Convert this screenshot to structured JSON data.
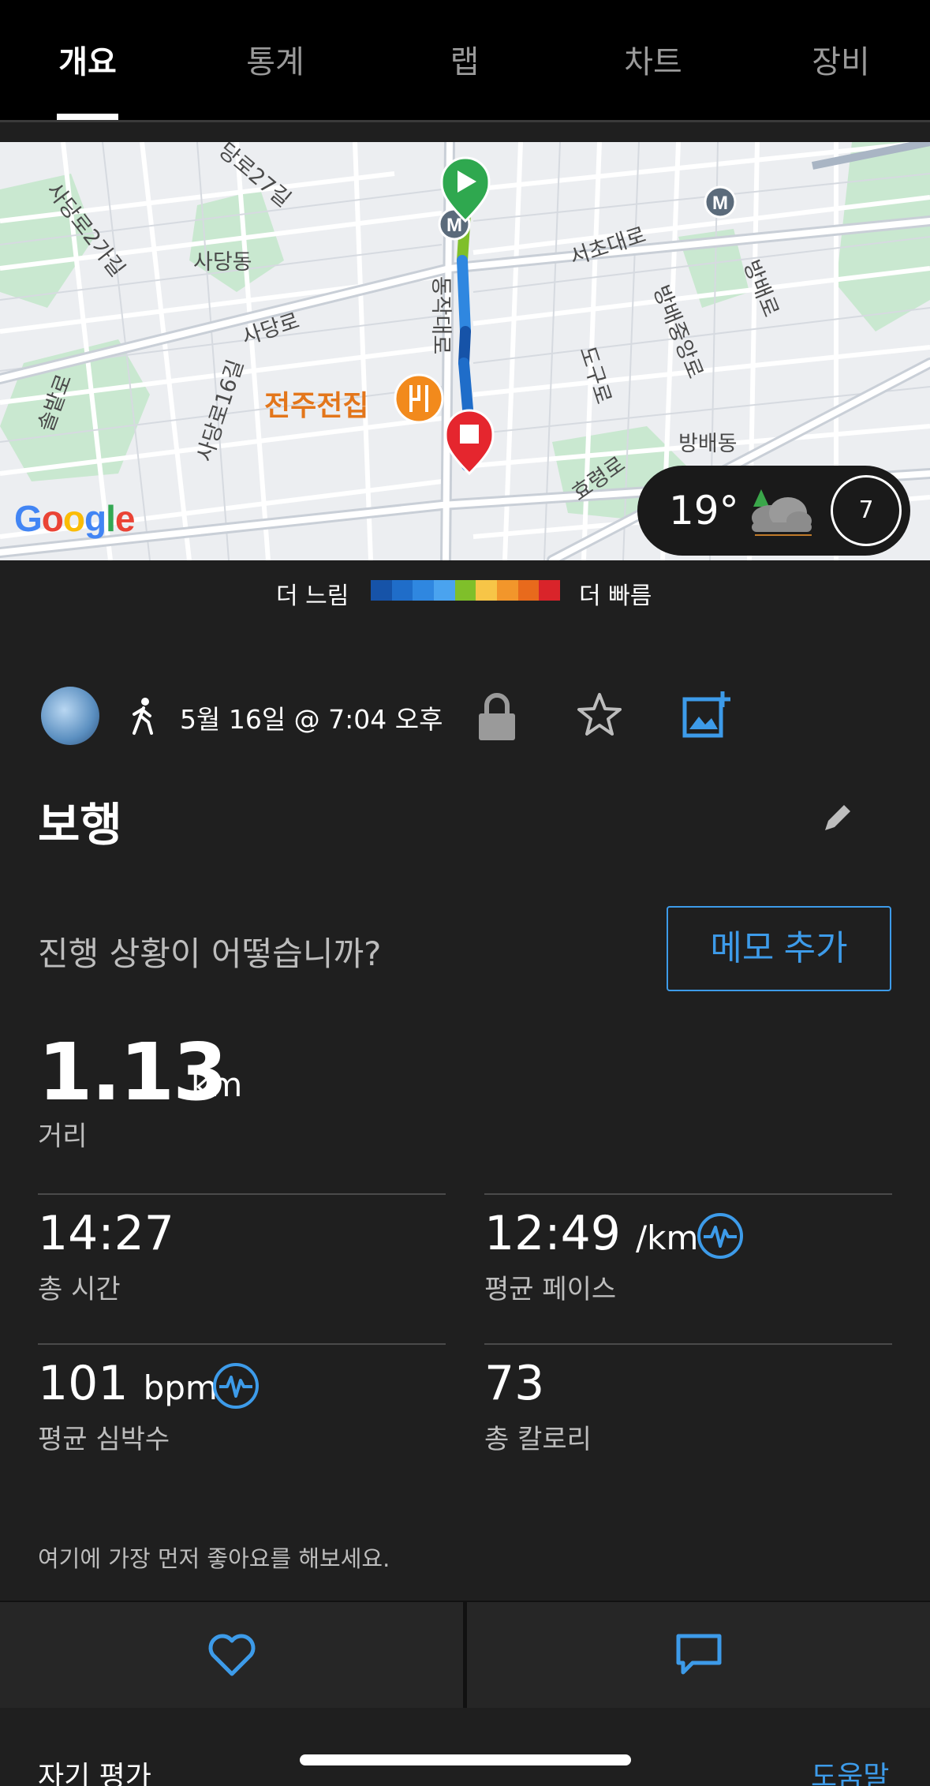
{
  "tabs": [
    {
      "label": "개요",
      "active": true
    },
    {
      "label": "통계",
      "active": false
    },
    {
      "label": "랩",
      "active": false
    },
    {
      "label": "차트",
      "active": false
    },
    {
      "label": "장비",
      "active": false
    }
  ],
  "map": {
    "labels": {
      "l1": "사당로2가길",
      "l2": "사당동",
      "l3": "사당로",
      "l4": "사당로16길",
      "l5": "솔밭로",
      "l6": "서초대로",
      "l7": "방배중앙로",
      "l8": "방배로",
      "l9": "도구로",
      "l10": "방배동",
      "l11": "효령로",
      "l12": "동작대로",
      "l13": "당로27길"
    },
    "poi": "전주전집",
    "attribution": "Google",
    "metro_marker": "M",
    "weather": {
      "temperature": "19°",
      "wind": "7",
      "icon": "rain-cloud-icon"
    }
  },
  "legend": {
    "slow": "더 느림",
    "fast": "더 빠름",
    "colors": [
      "#1653a8",
      "#1f6dc9",
      "#2f87e0",
      "#4aa3ef",
      "#7fbf2a",
      "#f7c547",
      "#f2962b",
      "#e86a1c",
      "#d9242a"
    ]
  },
  "activity": {
    "type_icon": "walking-icon",
    "datetime": "5월 16일 @ 7:04 오후",
    "title": "보행",
    "question": "진행 상황이 어떻습니까?",
    "memo_button": "메모 추가"
  },
  "stats": {
    "distance": {
      "value": "1.13",
      "unit": "km",
      "label": "거리"
    },
    "total_time": {
      "value": "14:27",
      "label": "총 시간"
    },
    "avg_pace": {
      "value": "12:49",
      "unit": "/km",
      "label": "평균 페이스"
    },
    "avg_hr": {
      "value": "101",
      "unit": "bpm",
      "label": "평균 심박수"
    },
    "calories": {
      "value": "73",
      "label": "총 칼로리"
    }
  },
  "social": {
    "likes_prompt": "여기에 가장 먼저 좋아요를 해보세요."
  },
  "footer": {
    "self_rating": "자기 평가",
    "help": "도움말"
  },
  "colors": {
    "accent": "#3d9be9",
    "background": "#1f1f1f",
    "poi": "#e3761b",
    "start": "#2fa84f",
    "end": "#e5262e"
  }
}
